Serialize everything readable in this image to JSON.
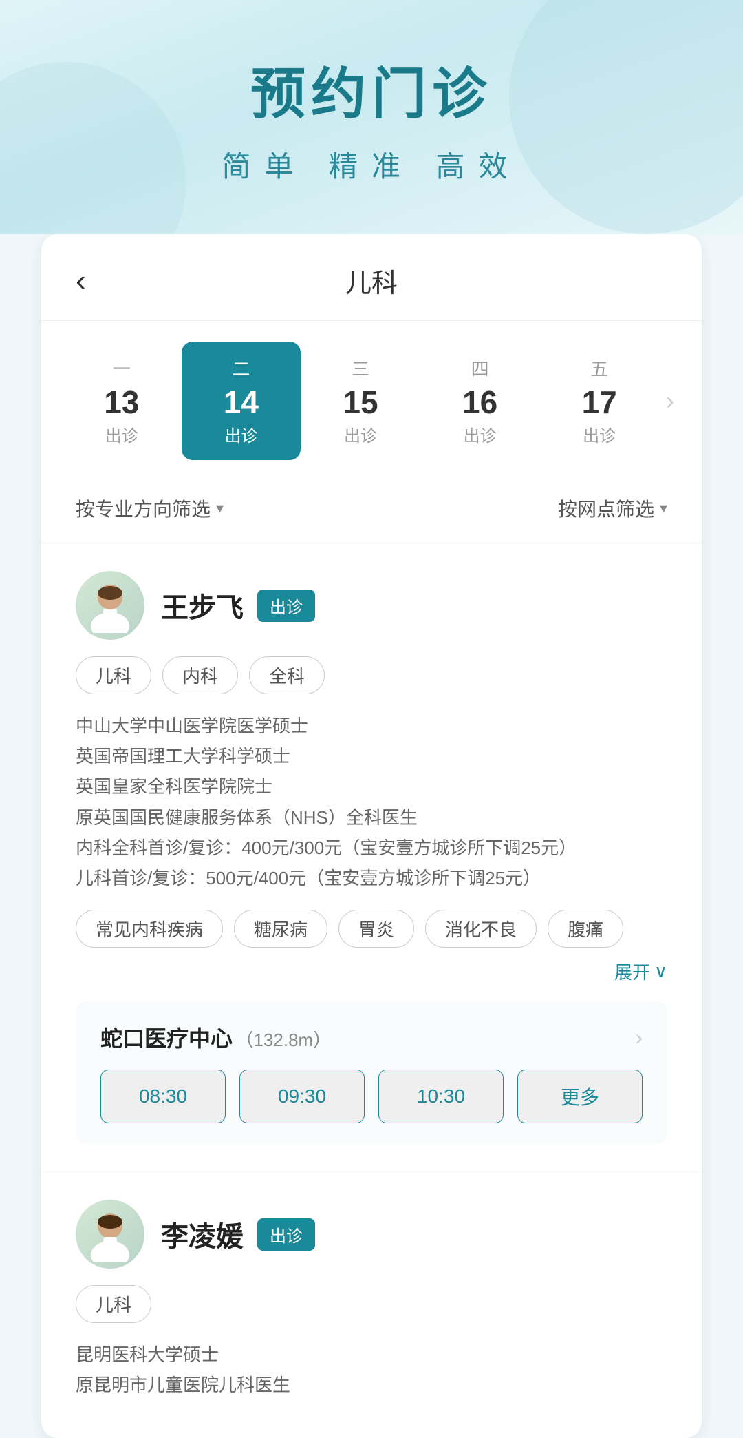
{
  "hero": {
    "title": "预约门诊",
    "subtitle": "简单 精准 高效"
  },
  "header": {
    "back_label": "‹",
    "title": "儿科"
  },
  "dates": [
    {
      "weekday": "一",
      "number": "13",
      "status": "出诊",
      "active": false
    },
    {
      "weekday": "二",
      "number": "14",
      "status": "出诊",
      "active": true
    },
    {
      "weekday": "三",
      "number": "15",
      "status": "出诊",
      "active": false
    },
    {
      "weekday": "四",
      "number": "16",
      "status": "出诊",
      "active": false
    },
    {
      "weekday": "五",
      "number": "17",
      "status": "出诊",
      "active": false
    }
  ],
  "filters": {
    "specialty_filter": "按专业方向筛选",
    "location_filter": "按网点筛选"
  },
  "doctors": [
    {
      "id": 1,
      "name": "王步飞",
      "status_badge": "出诊",
      "tags": [
        "儿科",
        "内科",
        "全科"
      ],
      "description": "中山大学中山医学院医学硕士\n英国帝国理工大学科学硕士\n英国皇家全科医学院院士\n原英国国民健康服务体系（NHS）全科医生\n内科全科首诊/复诊：400元/300元（宝安壹方城诊所下调25元）\n儿科首诊/复诊：500元/400元（宝安壹方城诊所下调25元）",
      "specialty_tags": [
        "常见内科疾病",
        "糖尿病",
        "胃炎",
        "消化不良",
        "腹痛"
      ],
      "expand_label": "展开",
      "clinic": {
        "name": "蛇口医疗中心",
        "distance": "（132.8m）",
        "time_slots": [
          "08:30",
          "09:30",
          "10:30",
          "更多"
        ]
      }
    },
    {
      "id": 2,
      "name": "李凌媛",
      "status_badge": "出诊",
      "tags": [
        "儿科"
      ],
      "description": "昆明医科大学硕士\n原昆明市儿童医院儿科医生",
      "specialty_tags": [],
      "expand_label": "",
      "clinic": null
    }
  ]
}
